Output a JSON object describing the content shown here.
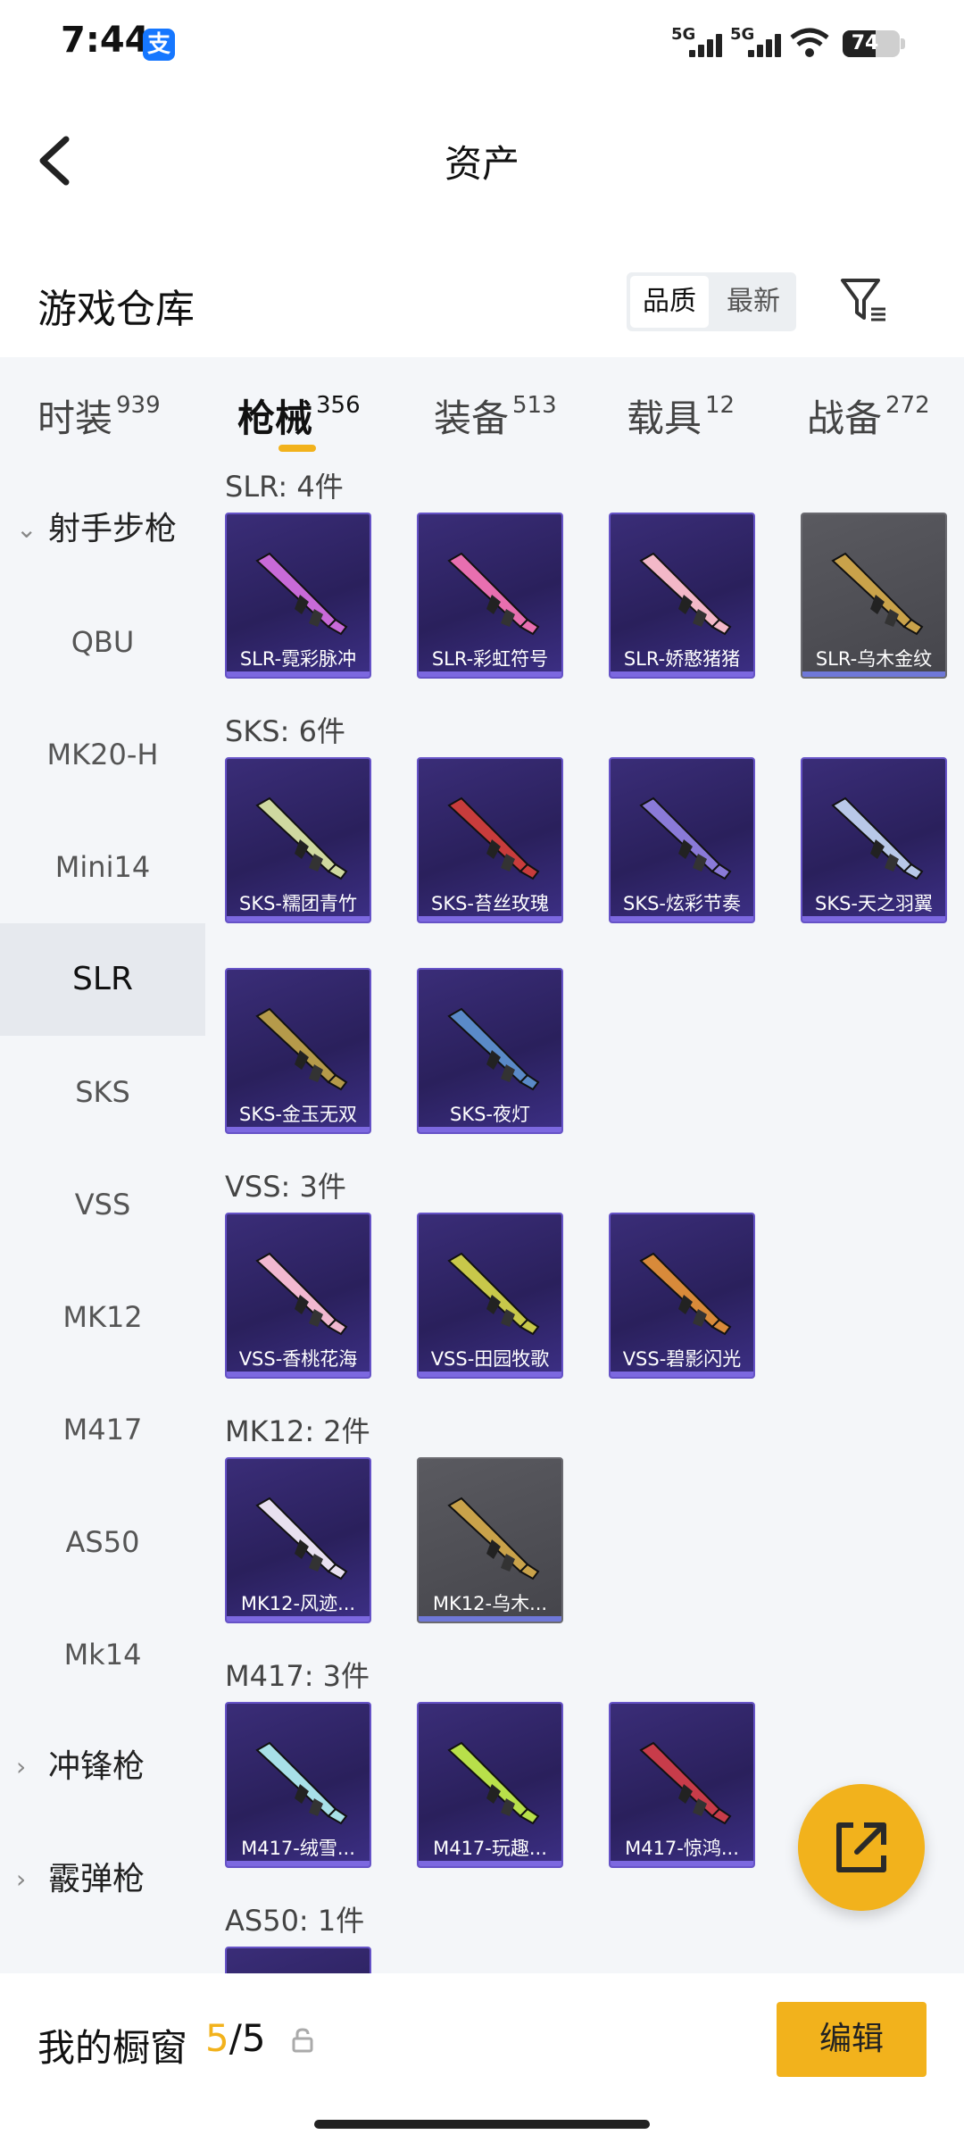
{
  "status": {
    "time": "7:44",
    "network1": "5G",
    "network2": "5G",
    "battery": "74",
    "battery_level": 0.74
  },
  "header": {
    "title": "资产"
  },
  "warehouse": {
    "title": "游戏仓库",
    "sort_options": [
      "品质",
      "最新"
    ],
    "sort_active": "品质"
  },
  "tabs": [
    {
      "label": "时装",
      "count": "939"
    },
    {
      "label": "枪械",
      "count": "356",
      "active": true
    },
    {
      "label": "装备",
      "count": "513"
    },
    {
      "label": "载具",
      "count": "12"
    },
    {
      "label": "战备",
      "count": "272"
    }
  ],
  "sidebar": {
    "groups": [
      {
        "label": "射手步枪",
        "expanded": true
      },
      {
        "label": "冲锋枪",
        "expanded": false
      },
      {
        "label": "霰弹枪",
        "expanded": false
      }
    ],
    "items": [
      "QBU",
      "MK20-H",
      "Mini14",
      "SLR",
      "SKS",
      "VSS",
      "MK12",
      "M417",
      "AS50",
      "Mk14"
    ],
    "active": "SLR"
  },
  "groups": [
    {
      "label": "SLR: 4件",
      "items": [
        {
          "name": "SLR-霓彩脉冲",
          "gray": false,
          "color": "#c86ad8"
        },
        {
          "name": "SLR-彩虹符号",
          "gray": false,
          "color": "#e86fb0"
        },
        {
          "name": "SLR-娇憨猪猪",
          "gray": false,
          "color": "#f3b8c8"
        },
        {
          "name": "SLR-乌木金纹",
          "gray": true,
          "color": "#c9a24a"
        }
      ]
    },
    {
      "label": "SKS: 6件",
      "items": [
        {
          "name": "SKS-糯团青竹",
          "gray": false,
          "color": "#cfd9a0"
        },
        {
          "name": "SKS-苔丝玫瑰",
          "gray": false,
          "color": "#c83c3c"
        },
        {
          "name": "SKS-炫彩节奏",
          "gray": false,
          "color": "#8a7ad8"
        },
        {
          "name": "SKS-天之羽翼",
          "gray": false,
          "color": "#b8c8e8"
        },
        {
          "name": "SKS-金玉无双",
          "gray": false,
          "color": "#b59a4a"
        },
        {
          "name": "SKS-夜灯",
          "gray": false,
          "color": "#5a8ac8"
        }
      ]
    },
    {
      "label": "VSS: 3件",
      "items": [
        {
          "name": "VSS-香桃花海",
          "gray": false,
          "color": "#f2b8d0"
        },
        {
          "name": "VSS-田园牧歌",
          "gray": false,
          "color": "#c8c84a"
        },
        {
          "name": "VSS-碧影闪光",
          "gray": false,
          "color": "#d88a3a"
        }
      ]
    },
    {
      "label": "MK12: 2件",
      "items": [
        {
          "name": "MK12-风迹...",
          "gray": false,
          "color": "#e8e0f0"
        },
        {
          "name": "MK12-乌木...",
          "gray": true,
          "color": "#c9a24a"
        }
      ]
    },
    {
      "label": "M417: 3件",
      "items": [
        {
          "name": "M417-绒雪...",
          "gray": false,
          "color": "#a8e0e8"
        },
        {
          "name": "M417-玩趣...",
          "gray": false,
          "color": "#b8e04a"
        },
        {
          "name": "M417-惊鸿...",
          "gray": false,
          "color": "#c83c4a"
        }
      ]
    },
    {
      "label": "AS50: 1件",
      "items": [
        {
          "name": "",
          "gray": false,
          "color": "#9a8ad8"
        }
      ]
    }
  ],
  "showcase": {
    "label": "我的橱窗",
    "current": "5",
    "total": "/5",
    "edit_label": "编辑"
  },
  "colors": {
    "accent": "#f2b21c",
    "panel": "#f4f6f9",
    "card_border": "#6653c7"
  }
}
